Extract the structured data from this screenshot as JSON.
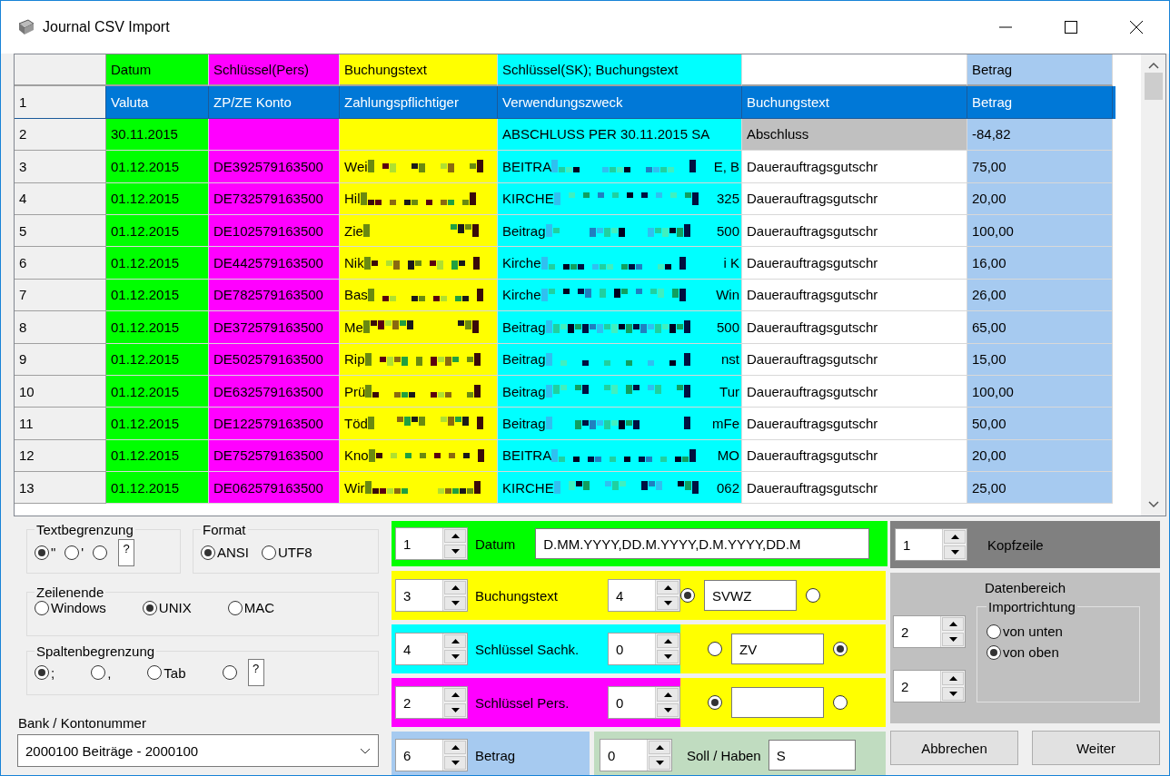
{
  "window": {
    "title": "Journal CSV Import"
  },
  "table": {
    "columns": [
      {
        "label": "Datum",
        "color": "#00ff00"
      },
      {
        "label": "Schlüssel(Pers)",
        "color": "#ff00ff"
      },
      {
        "label": "Buchungstext",
        "color": "#ffff00"
      },
      {
        "label": "Schlüssel(SK); Buchungstext",
        "color": "#00ffff"
      },
      {
        "color": "#ffffff"
      },
      {
        "label": "Betrag",
        "color": "#a6caf0"
      }
    ],
    "rows": [
      {
        "number": "1",
        "selected": true,
        "marked": false,
        "cells": [
          "Valuta",
          "ZP/ZE Konto",
          "Zahlungspflichtiger",
          "Verwendungszweck",
          "Buchungstext",
          "Betrag"
        ]
      },
      {
        "number": "2",
        "selected": false,
        "marked": true,
        "cells": [
          "30.11.2015",
          null,
          null,
          "ABSCHLUSS PER 30.11.2015 SA",
          "Abschluss",
          "-84,82"
        ]
      },
      {
        "number": "3",
        "selected": false,
        "marked": false,
        "cells": [
          "01.12.2015",
          "DE392579163500",
          {
            "text": "Wei",
            "redacted": true
          },
          {
            "text": "BEITRA",
            "redacted": true,
            "tail": "E, B"
          },
          "Dauerauftragsgutschr",
          "75,00"
        ]
      },
      {
        "number": "4",
        "selected": false,
        "marked": false,
        "cells": [
          "01.12.2015",
          "DE732579163500",
          {
            "text": "Hil",
            "redacted": true
          },
          {
            "text": "KIRCHE",
            "redacted": true,
            "tail": "325"
          },
          "Dauerauftragsgutschr",
          "20,00"
        ]
      },
      {
        "number": "5",
        "selected": false,
        "marked": false,
        "cells": [
          "01.12.2015",
          "DE102579163500",
          {
            "text": "Zie",
            "redacted": true
          },
          {
            "text": "Beitrag",
            "redacted": true,
            "tail": "500"
          },
          "Dauerauftragsgutschr",
          "100,00"
        ]
      },
      {
        "number": "6",
        "selected": false,
        "marked": false,
        "cells": [
          "01.12.2015",
          "DE442579163500",
          {
            "text": "Nik",
            "redacted": true
          },
          {
            "text": "Kirche",
            "redacted": true,
            "tail": "i K"
          },
          "Dauerauftragsgutschr",
          "16,00"
        ]
      },
      {
        "number": "7",
        "selected": false,
        "marked": false,
        "cells": [
          "01.12.2015",
          "DE782579163500",
          {
            "text": "Bas",
            "redacted": true
          },
          {
            "text": "Kirche",
            "redacted": true,
            "tail": "Win"
          },
          "Dauerauftragsgutschr",
          "26,00"
        ]
      },
      {
        "number": "8",
        "selected": false,
        "marked": false,
        "cells": [
          "01.12.2015",
          "DE372579163500",
          {
            "text": "Me",
            "redacted": true
          },
          {
            "text": "Beitrag",
            "redacted": true,
            "tail": "500"
          },
          "Dauerauftragsgutschr",
          "65,00"
        ]
      },
      {
        "number": "9",
        "selected": false,
        "marked": false,
        "cells": [
          "01.12.2015",
          "DE502579163500",
          {
            "text": "Rip",
            "redacted": true
          },
          {
            "text": "Beitrag",
            "redacted": true,
            "tail": "nst"
          },
          "Dauerauftragsgutschr",
          "15,00"
        ]
      },
      {
        "number": "10",
        "selected": false,
        "marked": false,
        "cells": [
          "01.12.2015",
          "DE632579163500",
          {
            "text": "Prü",
            "redacted": true
          },
          {
            "text": "Beitrag",
            "redacted": true,
            "tail": "Tur"
          },
          "Dauerauftragsgutschr",
          "100,00"
        ]
      },
      {
        "number": "11",
        "selected": false,
        "marked": false,
        "cells": [
          "01.12.2015",
          "DE122579163500",
          {
            "text": "Töd",
            "redacted": true
          },
          {
            "text": "Beitrag",
            "redacted": true,
            "tail": "mFe"
          },
          "Dauerauftragsgutschr",
          "50,00"
        ]
      },
      {
        "number": "12",
        "selected": false,
        "marked": false,
        "cells": [
          "01.12.2015",
          "DE752579163500",
          {
            "text": "Kno",
            "redacted": true
          },
          {
            "text": "BEITRA",
            "redacted": true,
            "tail": "MO"
          },
          "Dauerauftragsgutschr",
          "20,00"
        ]
      },
      {
        "number": "13",
        "selected": false,
        "marked": false,
        "cells": [
          "01.12.2015",
          "DE062579163500",
          {
            "text": "Wir",
            "redacted": true
          },
          {
            "text": "KIRCHE",
            "redacted": true,
            "tail": "062"
          },
          "Dauerauftragsgutschr",
          "25,00"
        ]
      }
    ]
  },
  "settings": {
    "text_delimiter": {
      "title": "Textbegrenzung",
      "options": [
        {
          "label": "\"",
          "selected": true
        },
        {
          "label": "'",
          "selected": false
        },
        {
          "kind": "custom",
          "value": "?",
          "selected": false
        }
      ]
    },
    "format": {
      "title": "Format",
      "options": [
        {
          "label": "ANSI",
          "selected": true
        },
        {
          "label": "UTF8",
          "selected": false
        }
      ]
    },
    "line_ending": {
      "title": "Zeilenende",
      "options": [
        {
          "label": "Windows",
          "selected": false
        },
        {
          "label": "UNIX",
          "selected": true
        },
        {
          "label": "MAC",
          "selected": false
        }
      ]
    },
    "column_delimiter": {
      "title": "Spaltenbegrenzung",
      "options": [
        {
          "label": ";",
          "selected": true
        },
        {
          "label": ",",
          "selected": false
        },
        {
          "label": "Tab",
          "selected": false
        },
        {
          "kind": "custom",
          "value": "?",
          "selected": false
        }
      ]
    },
    "bank": {
      "label": "Bank / Kontonummer",
      "value": "2000100 Beiträge - 2000100"
    }
  },
  "mapping": {
    "date": {
      "column": "1",
      "label": "Datum",
      "color": "#00ff00",
      "formats": "D.MM.YYYY,DD.M.YYYY,D.M.YYYY,DD.M"
    },
    "fields": [
      {
        "column": "3",
        "label": "Buchungstext",
        "color": "#ffff00",
        "length": "4",
        "option": {
          "color": "#ffff00",
          "left_selected": true,
          "code": "SVWZ",
          "right_selected": false
        }
      },
      {
        "column": "4",
        "label": "Schlüssel Sachk.",
        "color": "#00ffff",
        "length": "0",
        "option": {
          "color": "#ffff00",
          "left_selected": false,
          "code": "ZV",
          "right_selected": true
        }
      },
      {
        "column": "2",
        "label": "Schlüssel Pers.",
        "color": "#ff00ff",
        "length": "0",
        "option": {
          "color": "#ffff00",
          "left_selected": true,
          "right_selected": false
        }
      }
    ],
    "amount": {
      "column": "6",
      "label": "Betrag",
      "color": "#a6caf0"
    },
    "debit_credit": {
      "column": "0",
      "label": "Soll / Haben",
      "value": "S",
      "color": "#c0dcc0"
    }
  },
  "range": {
    "header": {
      "value": "1",
      "label": "Kopfzeile"
    },
    "data": {
      "title": "Datenbereich",
      "from": "2",
      "to": "2",
      "direction": {
        "title": "Importrichtung",
        "options": [
          {
            "label": "von unten",
            "selected": false
          },
          {
            "label": "von oben",
            "selected": true
          }
        ]
      }
    },
    "buttons": [
      "Abbrechen",
      "Weiter"
    ]
  }
}
